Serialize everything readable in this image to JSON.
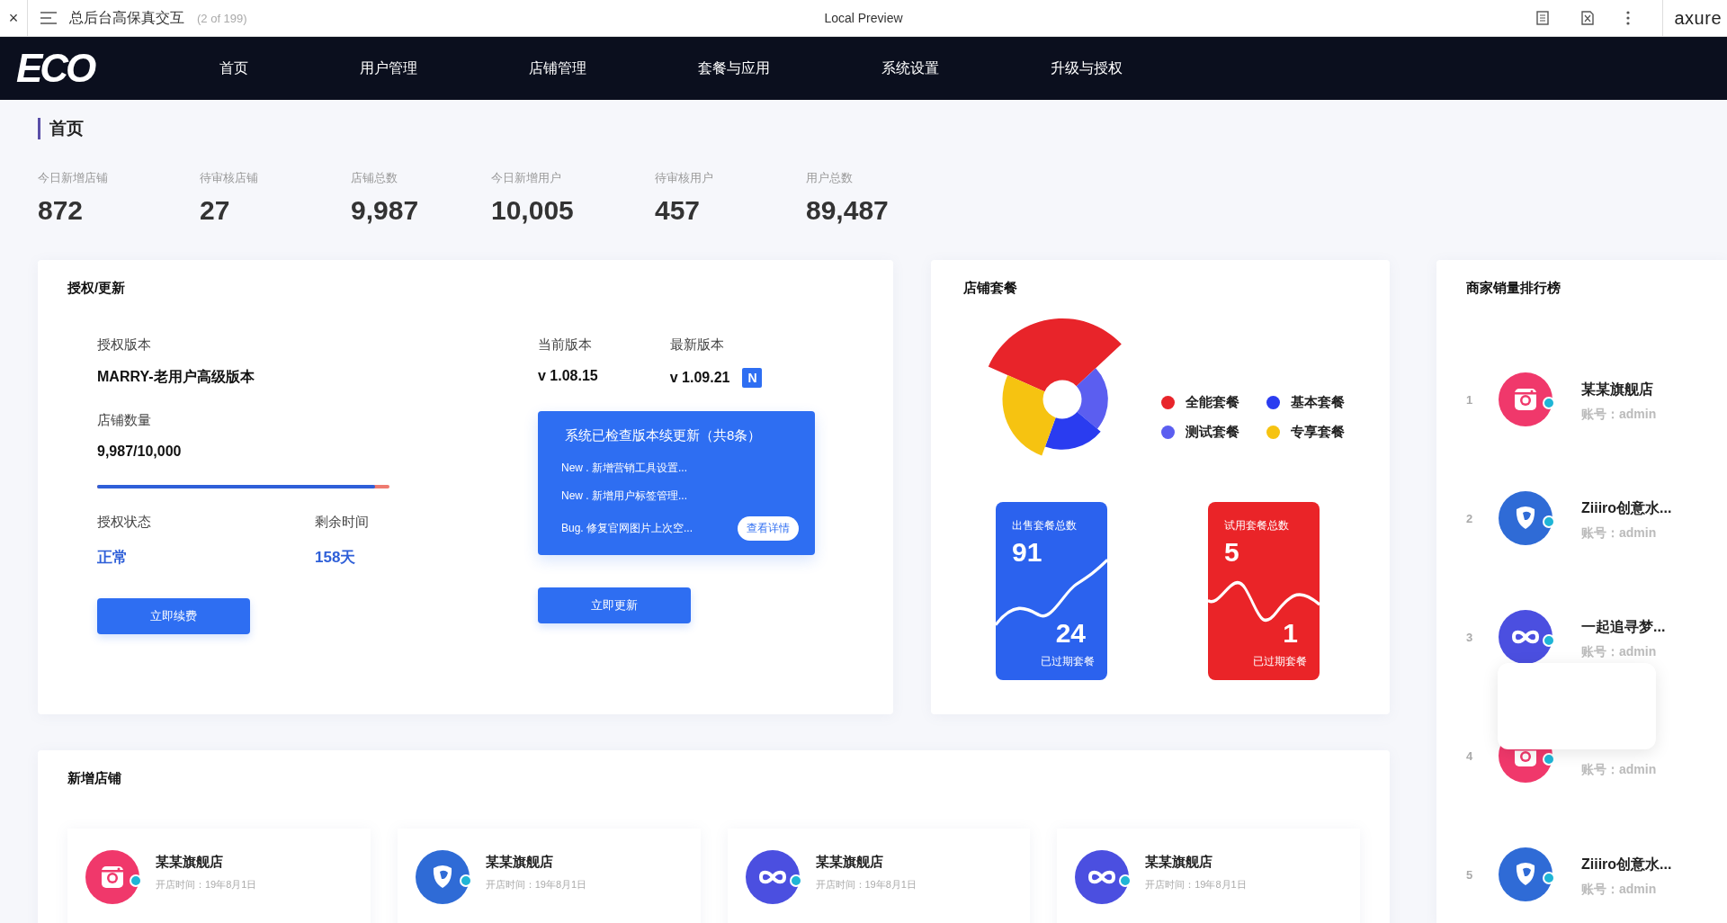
{
  "browser": {
    "close": "×",
    "title": "总后台高保真交互",
    "page_count": "(2 of 199)",
    "center_title": "Local Preview",
    "brand": "axure"
  },
  "nav": {
    "logo": "ECO",
    "items": [
      {
        "label": "首页"
      },
      {
        "label": "用户管理"
      },
      {
        "label": "店铺管理"
      },
      {
        "label": "套餐与应用"
      },
      {
        "label": "系统设置"
      },
      {
        "label": "升级与授权"
      }
    ]
  },
  "page_title": "首页",
  "stats": [
    {
      "label": "今日新增店铺",
      "value": "872"
    },
    {
      "label": "待审核店铺",
      "value": "27"
    },
    {
      "label": "店铺总数",
      "value": "9,987"
    },
    {
      "label": "今日新增用户",
      "value": "10,005"
    },
    {
      "label": "待审核用户",
      "value": "457"
    },
    {
      "label": "用户总数",
      "value": "89,487"
    }
  ],
  "license": {
    "title": "授权/更新",
    "edition_label": "授权版本",
    "edition": "MARRY-老用户高级版本",
    "shops_label": "店铺数量",
    "shops": "9,987/10,000",
    "shops_usage": {
      "level": 0.95
    },
    "status_label": "授权状态",
    "status": "正常",
    "remaining_label": "剩余时间",
    "remaining": "158天",
    "renew_button": "立即续费",
    "current_label": "当前版本",
    "current": "v 1.08.15",
    "latest_label": "最新版本",
    "latest": "v 1.09.21",
    "new_badge": "N",
    "update_box": {
      "title": "系统已检查版本续更新（共8条）",
      "lines": [
        "New . 新增营销工具设置...",
        "New . 新增用户标签管理...",
        "Bug. 修复官网图片上次空..."
      ],
      "details_button": "查看详情"
    },
    "update_button": "立即更新"
  },
  "packages": {
    "title": "店铺套餐",
    "legend": [
      {
        "label": "全能套餐",
        "color": "#e8242a"
      },
      {
        "label": "基本套餐",
        "color": "#2a3cf0"
      },
      {
        "label": "测试套餐",
        "color": "#5b5ef0"
      },
      {
        "label": "专享套餐",
        "color": "#f6c311"
      }
    ],
    "cards": [
      {
        "kind": "sold",
        "label": "出售套餐总数",
        "total": "91",
        "expired": "24",
        "expired_label": "已过期套餐"
      },
      {
        "kind": "trial",
        "label": "试用套餐总数",
        "total": "5",
        "expired": "1",
        "expired_label": "已过期套餐"
      }
    ]
  },
  "ranking": {
    "title": "商家销量排行榜",
    "items": [
      {
        "rank": "1",
        "kind": "camera",
        "name": "某某旗舰店",
        "account": "账号：admin"
      },
      {
        "rank": "2",
        "kind": "shield",
        "name": "Ziiiro创意水...",
        "account": "账号：admin"
      },
      {
        "rank": "3",
        "kind": "infinity",
        "name": "一起追寻梦...",
        "account": "账号：admin"
      },
      {
        "rank": "4",
        "kind": "camera",
        "account": "账号：admin"
      },
      {
        "rank": "5",
        "kind": "shield",
        "name": "Ziiiro创意水...",
        "account": "账号：admin"
      }
    ]
  },
  "new_shops": {
    "title": "新增店铺",
    "items": [
      {
        "kind": "camera",
        "name": "某某旗舰店",
        "opened": "开店时间：19年8月1日"
      },
      {
        "kind": "shield",
        "name": "某某旗舰店",
        "opened": "开店时间：19年8月1日"
      },
      {
        "kind": "infinity",
        "name": "某某旗舰店",
        "opened": "开店时间：19年8月1日"
      },
      {
        "kind": "infinity",
        "name": "某某旗舰店",
        "opened": "开店时间：19年8月1日"
      }
    ]
  }
}
